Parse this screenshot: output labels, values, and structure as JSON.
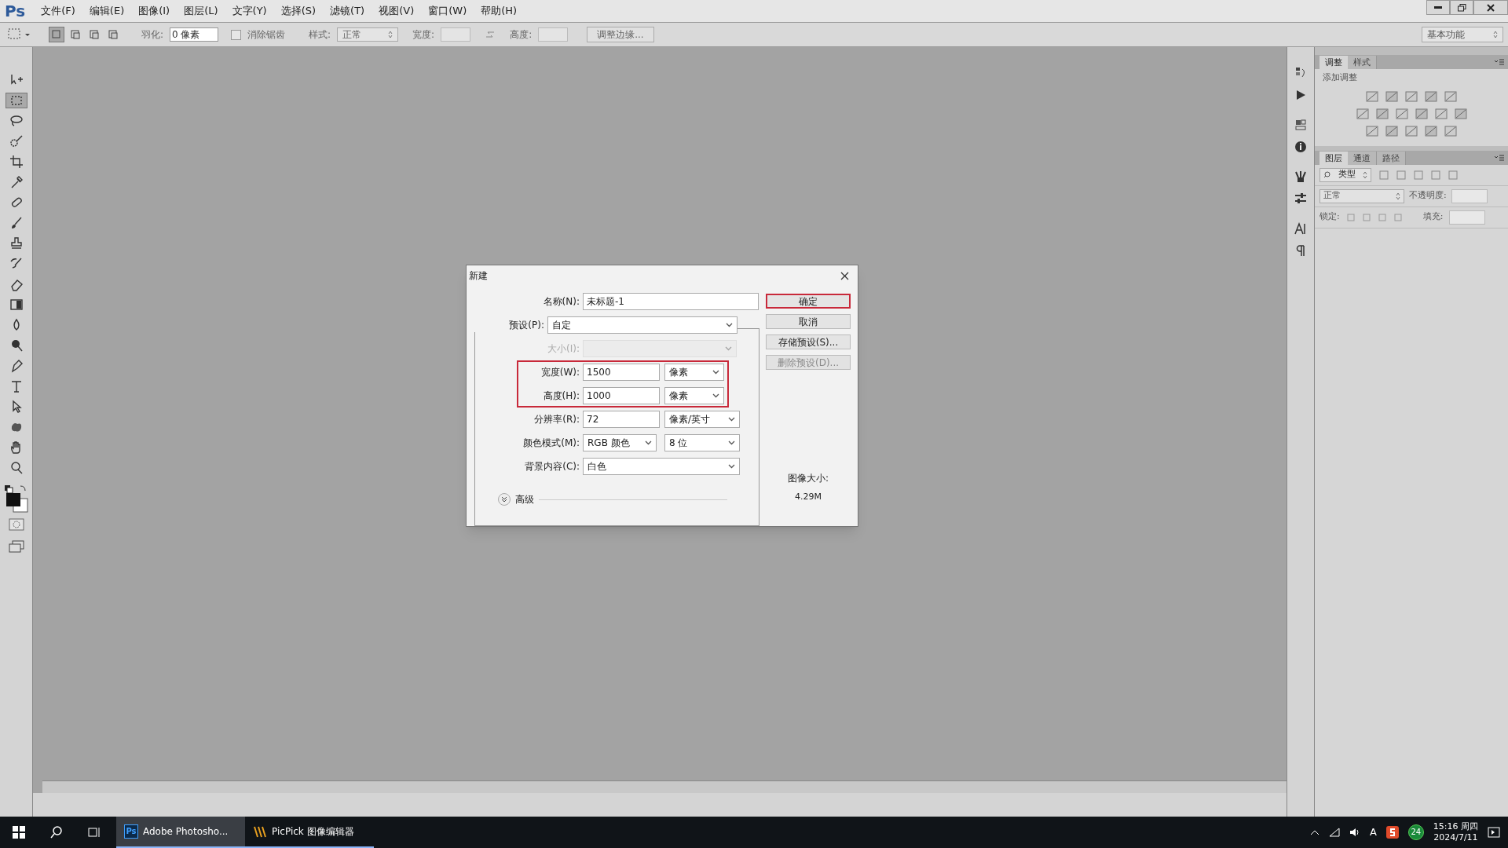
{
  "menu_bar": {
    "logo": "Ps",
    "items": [
      "文件(F)",
      "编辑(E)",
      "图像(I)",
      "图层(L)",
      "文字(Y)",
      "选择(S)",
      "滤镜(T)",
      "视图(V)",
      "窗口(W)",
      "帮助(H)"
    ]
  },
  "options_bar": {
    "feather_label": "羽化:",
    "feather_value": "0 像素",
    "antialias": {
      "label": "消除锯齿",
      "checked": false
    },
    "style_label": "样式:",
    "style_value": "正常",
    "width_label": "宽度:",
    "height_label": "高度:",
    "refine_button": "调整边缘...",
    "workspace": "基本功能"
  },
  "tools": [
    {
      "kind": "move",
      "selected": false
    },
    {
      "kind": "marquee",
      "selected": true
    },
    {
      "kind": "lasso",
      "selected": false
    },
    {
      "kind": "quick-select",
      "selected": false
    },
    {
      "kind": "crop",
      "selected": false
    },
    {
      "kind": "eyedropper",
      "selected": false
    },
    {
      "kind": "healing",
      "selected": false
    },
    {
      "kind": "brush",
      "selected": false
    },
    {
      "kind": "stamp",
      "selected": false
    },
    {
      "kind": "history-brush",
      "selected": false
    },
    {
      "kind": "eraser",
      "selected": false
    },
    {
      "kind": "gradient",
      "selected": false
    },
    {
      "kind": "blur",
      "selected": false
    },
    {
      "kind": "dodge",
      "selected": false
    },
    {
      "kind": "pen",
      "selected": false
    },
    {
      "kind": "type",
      "selected": false
    },
    {
      "kind": "path-select",
      "selected": false
    },
    {
      "kind": "shape",
      "selected": false
    },
    {
      "kind": "hand",
      "selected": false
    },
    {
      "kind": "zoom",
      "selected": false
    }
  ],
  "dialog": {
    "title": "新建",
    "name": {
      "label": "名称(N):",
      "value": "未标题-1"
    },
    "preset": {
      "label": "预设(P):",
      "value": "自定"
    },
    "size": {
      "label": "大小(I):",
      "disabled": true
    },
    "width": {
      "label": "宽度(W):",
      "value": "1500",
      "unit": "像素"
    },
    "height": {
      "label": "高度(H):",
      "value": "1000",
      "unit": "像素"
    },
    "dimensions_highlighted": true,
    "resolution": {
      "label": "分辨率(R):",
      "value": "72",
      "unit": "像素/英寸"
    },
    "color_mode": {
      "label": "颜色模式(M):",
      "value": "RGB 颜色",
      "depth": "8 位"
    },
    "background": {
      "label": "背景内容(C):",
      "value": "白色"
    },
    "advanced": {
      "label": "高级",
      "expanded": false
    },
    "buttons": [
      {
        "label": "确定",
        "highlighted": true,
        "disabled": false
      },
      {
        "label": "取消",
        "highlighted": false,
        "disabled": false
      },
      {
        "label": "存储预设(S)...",
        "highlighted": false,
        "disabled": false
      },
      {
        "label": "删除预设(D)...",
        "highlighted": false,
        "disabled": true
      }
    ],
    "image_size": {
      "label": "图像大小:",
      "value": "4.29M"
    }
  },
  "adjustments_panel": {
    "tabs": [
      {
        "label": "调整",
        "selected": true
      },
      {
        "label": "样式",
        "selected": false
      }
    ],
    "heading": "添加调整"
  },
  "layers_panel": {
    "tabs": [
      {
        "label": "图层",
        "selected": true
      },
      {
        "label": "通道",
        "selected": false
      },
      {
        "label": "路径",
        "selected": false
      }
    ],
    "filter": "类型",
    "blend_mode": "正常",
    "opacity_label": "不透明度:",
    "lock_label": "锁定:",
    "fill_label": "填充:"
  },
  "taskbar": {
    "apps": [
      {
        "label": "Adobe Photosho...",
        "icon": "Ps",
        "active": true
      },
      {
        "label": "PicPick 图像编辑器",
        "active": false
      }
    ],
    "ime": "A",
    "badge": "24",
    "time": "15:16 周四",
    "date": "2024/7/11"
  }
}
